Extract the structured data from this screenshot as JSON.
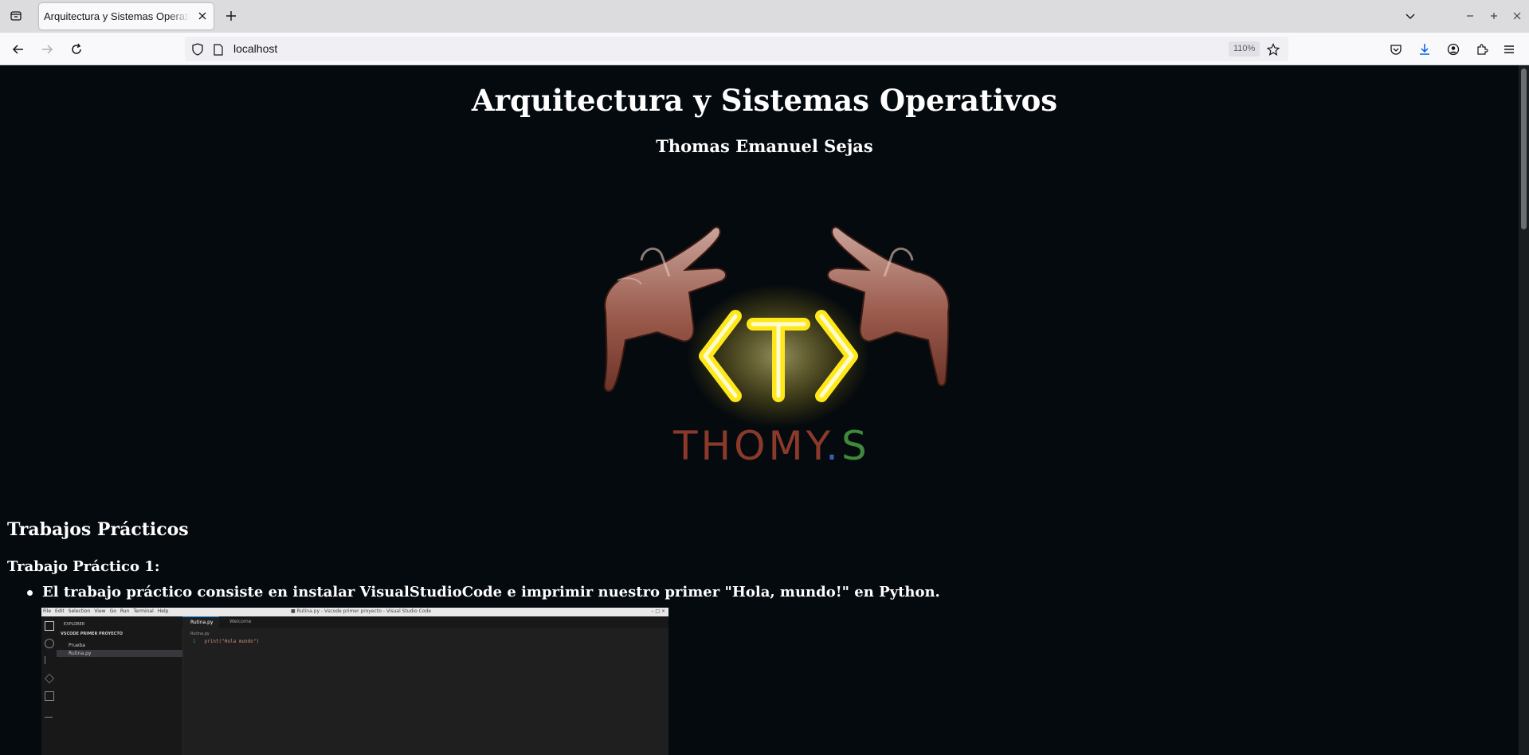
{
  "browser": {
    "tab_title": "Arquitectura y Sistemas Operativos",
    "url": "localhost",
    "zoom": "110%"
  },
  "page": {
    "title": "Arquitectura y Sistemas Operativos",
    "subtitle": "Thomas Emanuel Sejas",
    "logo": {
      "text_left": "THOMY",
      "text_dot": ".",
      "text_right": "S",
      "emblem": "T",
      "colors": {
        "text_main": "#8b3a2a",
        "dot": "#3b5bb5",
        "s": "#3f8a3a",
        "glow": "#ffe81a"
      }
    },
    "section_heading": "Trabajos Prácticos",
    "tp1": {
      "heading": "Trabajo Práctico 1:",
      "bullet": "El trabajo práctico consiste en instalar VisualStudioCode e imprimir nuestro primer \"Hola, mundo!\" en Python."
    },
    "screenshot": {
      "menu": [
        "File",
        "Edit",
        "Selection",
        "View",
        "Go",
        "Run",
        "Terminal",
        "Help"
      ],
      "window_title": "■ Rutina.py - Vscode primer proyecto - Visual Studio Code",
      "explorer_label": "EXPLORER",
      "project_label": "VSCODE PRIMER PROYECTO",
      "tree": [
        "Prueba",
        "Rutina.py"
      ],
      "tabs": [
        "Rutina.py",
        "Welcome"
      ],
      "breadcrumb": "Rutina.py",
      "line_number": "1",
      "code": "print(\"Hola mundo\")"
    }
  }
}
